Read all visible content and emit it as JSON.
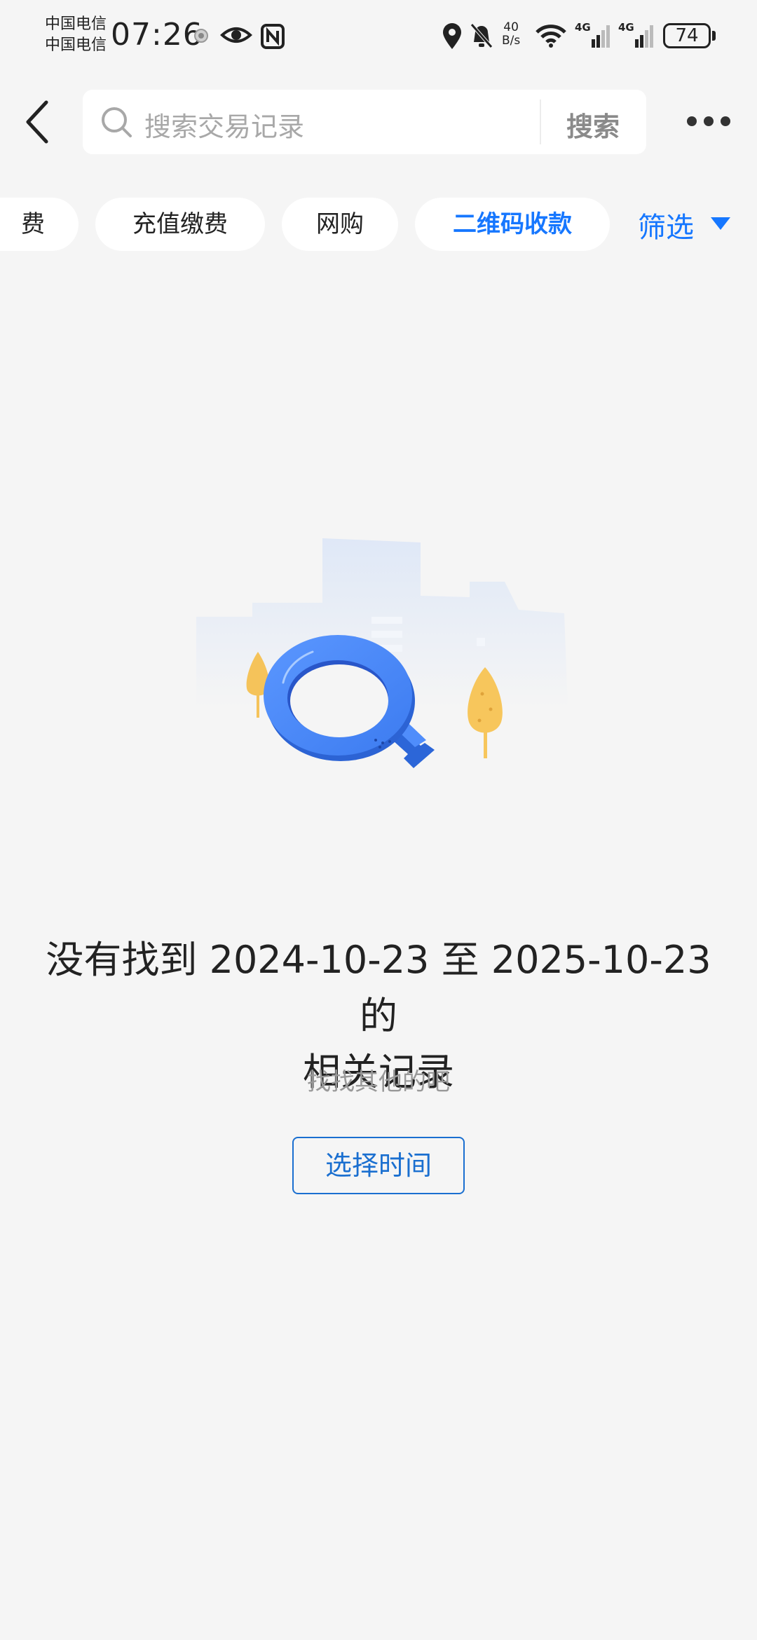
{
  "status_bar": {
    "carrier_1": "中国电信",
    "carrier_2": "中国电信",
    "time": "07:26",
    "net_speed_value": "40",
    "net_speed_unit": "B/s",
    "signal_1": "4G",
    "signal_2": "4G",
    "battery": "74",
    "icons": [
      "record-icon",
      "eye-icon",
      "nfc-icon",
      "location-icon",
      "bell-off-icon",
      "wifi-icon",
      "signal-icon",
      "signal-icon",
      "battery-icon"
    ]
  },
  "header": {
    "search_placeholder": "搜索交易记录",
    "search_button": "搜索",
    "icons": [
      "back-arrow-icon",
      "search-icon",
      "more-icon"
    ]
  },
  "filters": {
    "chips": [
      {
        "label": "费",
        "active": false
      },
      {
        "label": "充值缴费",
        "active": false
      },
      {
        "label": "网购",
        "active": false
      },
      {
        "label": "二维码收款",
        "active": true
      }
    ],
    "filter_label": "筛选",
    "accent_color": "#1677ff"
  },
  "empty_state": {
    "title_line_1": "没有找到 2024-10-23 至 2025-10-23 的",
    "title_line_2": "相关记录",
    "subtitle": "找找其他的吧",
    "button": "选择时间",
    "illustration": "magnifier-illustration"
  }
}
